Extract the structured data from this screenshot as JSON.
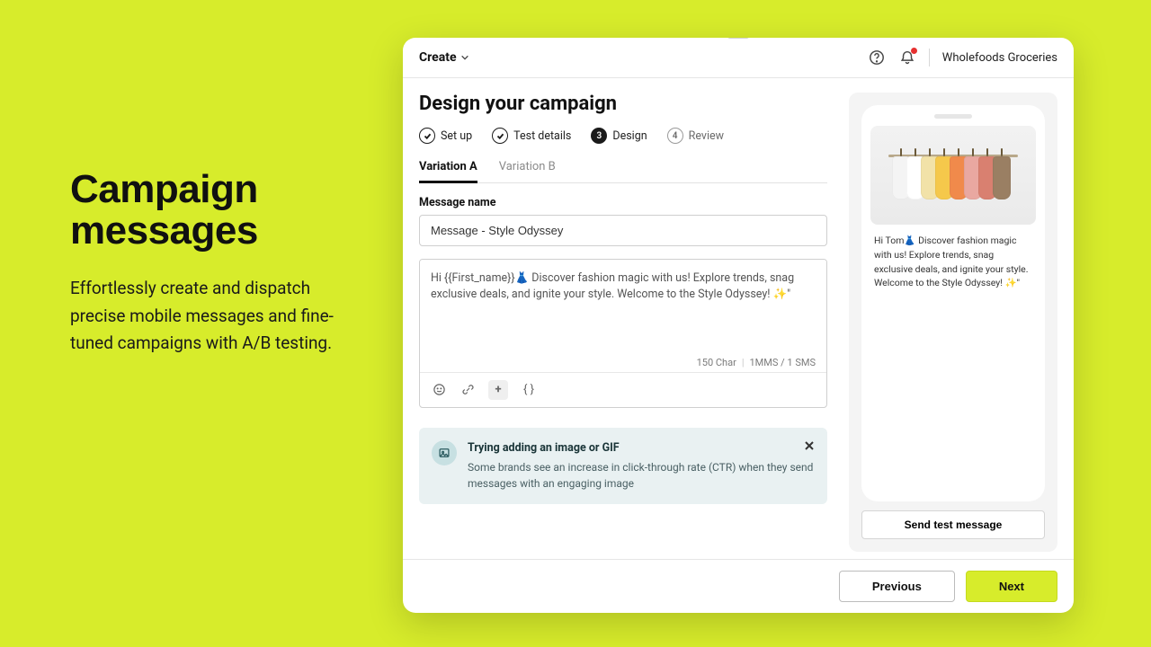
{
  "promo": {
    "headline": "Campaign messages",
    "body": "Effortlessly create and dispatch precise mobile messages and fine-tuned campaigns with A/B testing."
  },
  "topbar": {
    "create_label": "Create",
    "org_name": "Wholefoods Groceries"
  },
  "page": {
    "title": "Design your campaign",
    "steps": [
      {
        "label": "Set up",
        "state": "done"
      },
      {
        "label": "Test details",
        "state": "done"
      },
      {
        "label": "Design",
        "num": "3",
        "state": "current"
      },
      {
        "label": "Review",
        "num": "4",
        "state": "inactive"
      }
    ],
    "tabs": [
      {
        "label": "Variation A",
        "active": true
      },
      {
        "label": "Variation  B",
        "active": false
      }
    ],
    "message_name_label": "Message name",
    "message_name_value": "Message - Style Odyssey",
    "message_body": "Hi {{First_name}}👗 Discover fashion magic with us! Explore trends, snag exclusive deals, and ignite your style. Welcome to the Style Odyssey! ✨\"",
    "char_meta": "150 Char",
    "sms_meta": "1MMS / 1 SMS",
    "toolbar_code_symbol": "{ }"
  },
  "tip": {
    "title": "Trying adding an image or GIF",
    "body": "Some brands see an increase in click-through rate (CTR) when they send messages with an engaging image"
  },
  "preview": {
    "message": "Hi Tom👗 Discover fashion magic with us! Explore trends, snag exclusive deals, and ignite your style. Welcome to the Style Odyssey! ✨\"",
    "send_test_label": "Send test message",
    "shirt_colors": [
      "#f4f4f4",
      "#ffffff",
      "#f2e2a8",
      "#f5c84b",
      "#f08a4b",
      "#e9a8a1",
      "#d98070",
      "#9a7f63"
    ]
  },
  "footer": {
    "previous": "Previous",
    "next": "Next"
  }
}
